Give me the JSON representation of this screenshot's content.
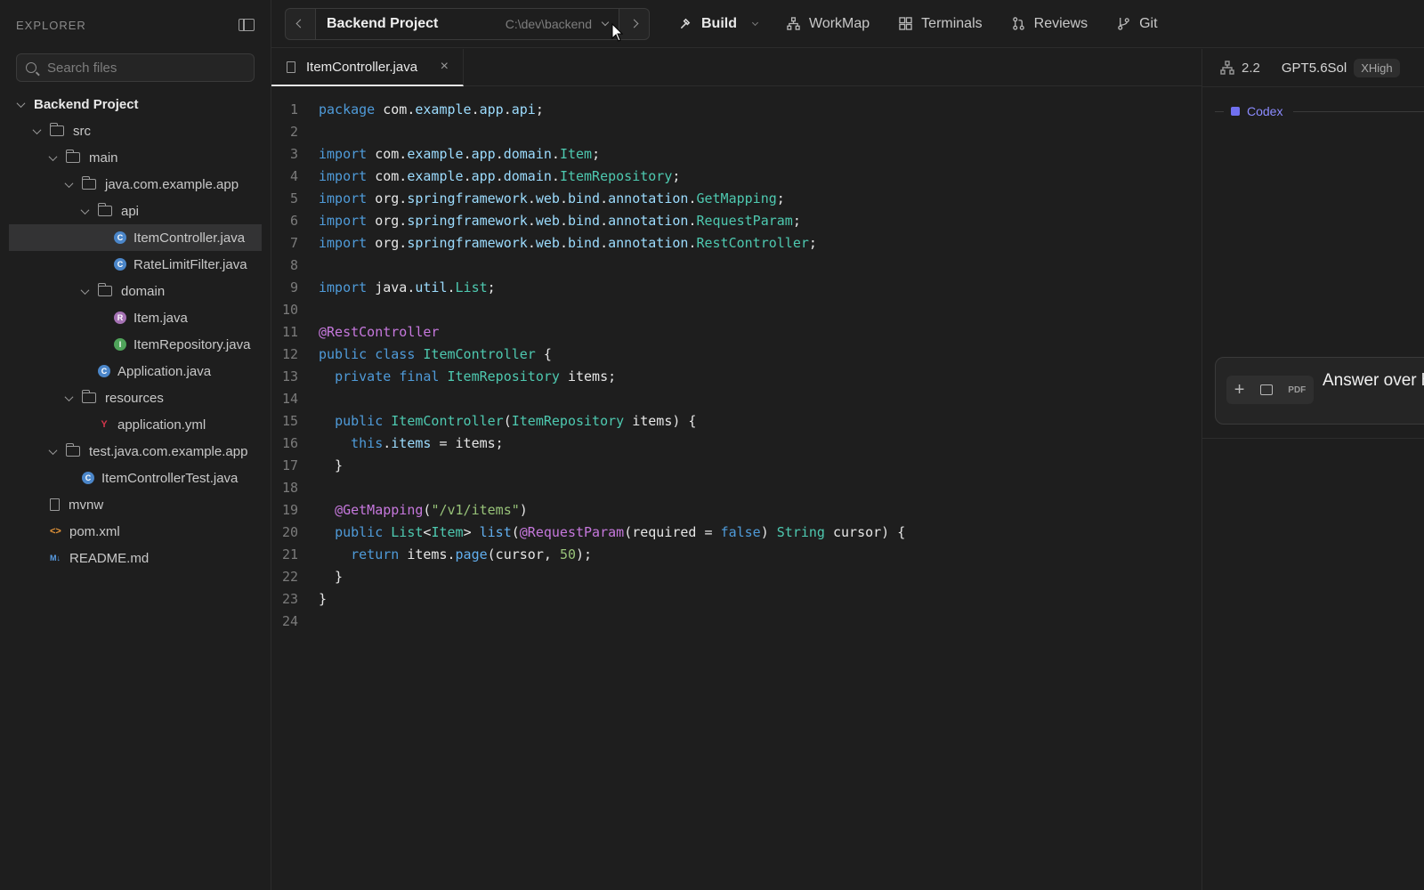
{
  "explorer": {
    "title": "EXPLORER",
    "search_placeholder": "Search files",
    "tree": [
      {
        "label": "Backend Project",
        "depth": 0,
        "type": "root"
      },
      {
        "label": "src",
        "depth": 1,
        "type": "folder"
      },
      {
        "label": "main",
        "depth": 2,
        "type": "folder"
      },
      {
        "label": "java.com.example.app",
        "depth": 3,
        "type": "folder"
      },
      {
        "label": "api",
        "depth": 4,
        "type": "folder"
      },
      {
        "label": "ItemController.java",
        "depth": 5,
        "type": "class",
        "selected": true
      },
      {
        "label": "RateLimitFilter.java",
        "depth": 5,
        "type": "class"
      },
      {
        "label": "domain",
        "depth": 4,
        "type": "folder"
      },
      {
        "label": "Item.java",
        "depth": 5,
        "type": "record"
      },
      {
        "label": "ItemRepository.java",
        "depth": 5,
        "type": "interface"
      },
      {
        "label": "Application.java",
        "depth": 4,
        "type": "class"
      },
      {
        "label": "resources",
        "depth": 3,
        "type": "folder"
      },
      {
        "label": "application.yml",
        "depth": 4,
        "type": "yml"
      },
      {
        "label": "test.java.com.example.app",
        "depth": 2,
        "type": "folder"
      },
      {
        "label": "ItemControllerTest.java",
        "depth": 3,
        "type": "class"
      },
      {
        "label": "mvnw",
        "depth": 1,
        "type": "file"
      },
      {
        "label": "pom.xml",
        "depth": 1,
        "type": "xml"
      },
      {
        "label": "README.md",
        "depth": 1,
        "type": "md"
      }
    ]
  },
  "topbar": {
    "project_name": "Backend Project",
    "project_path": "C:\\dev\\backend",
    "menu": [
      {
        "label": "Build",
        "icon": "hammer-icon"
      },
      {
        "label": "WorkMap",
        "icon": "sitemap-icon"
      },
      {
        "label": "Terminals",
        "icon": "grid-icon"
      },
      {
        "label": "Reviews",
        "icon": "git-pull-request-icon"
      },
      {
        "label": "Git",
        "icon": "git-branch-icon"
      }
    ]
  },
  "editor": {
    "tab_label": "ItemController.java",
    "tab_close": "×",
    "lines": [
      [
        [
          "kw",
          "package"
        ],
        [
          "p",
          " com."
        ],
        [
          "id",
          "example"
        ],
        [
          "p",
          "."
        ],
        [
          "id",
          "app"
        ],
        [
          "p",
          "."
        ],
        [
          "id",
          "api"
        ],
        [
          "p",
          ";"
        ]
      ],
      [],
      [
        [
          "kw",
          "import"
        ],
        [
          "p",
          " com."
        ],
        [
          "id",
          "example"
        ],
        [
          "p",
          "."
        ],
        [
          "id",
          "app"
        ],
        [
          "p",
          "."
        ],
        [
          "id",
          "domain"
        ],
        [
          "p",
          "."
        ],
        [
          "ty",
          "Item"
        ],
        [
          "p",
          ";"
        ]
      ],
      [
        [
          "kw",
          "import"
        ],
        [
          "p",
          " com."
        ],
        [
          "id",
          "example"
        ],
        [
          "p",
          "."
        ],
        [
          "id",
          "app"
        ],
        [
          "p",
          "."
        ],
        [
          "id",
          "domain"
        ],
        [
          "p",
          "."
        ],
        [
          "ty",
          "ItemRepository"
        ],
        [
          "p",
          ";"
        ]
      ],
      [
        [
          "kw",
          "import"
        ],
        [
          "p",
          " org."
        ],
        [
          "id",
          "springframework"
        ],
        [
          "p",
          "."
        ],
        [
          "id",
          "web"
        ],
        [
          "p",
          "."
        ],
        [
          "id",
          "bind"
        ],
        [
          "p",
          "."
        ],
        [
          "id",
          "annotation"
        ],
        [
          "p",
          "."
        ],
        [
          "ty",
          "GetMapping"
        ],
        [
          "p",
          ";"
        ]
      ],
      [
        [
          "kw",
          "import"
        ],
        [
          "p",
          " org."
        ],
        [
          "id",
          "springframework"
        ],
        [
          "p",
          "."
        ],
        [
          "id",
          "web"
        ],
        [
          "p",
          "."
        ],
        [
          "id",
          "bind"
        ],
        [
          "p",
          "."
        ],
        [
          "id",
          "annotation"
        ],
        [
          "p",
          "."
        ],
        [
          "ty",
          "RequestParam"
        ],
        [
          "p",
          ";"
        ]
      ],
      [
        [
          "kw",
          "import"
        ],
        [
          "p",
          " org."
        ],
        [
          "id",
          "springframework"
        ],
        [
          "p",
          "."
        ],
        [
          "id",
          "web"
        ],
        [
          "p",
          "."
        ],
        [
          "id",
          "bind"
        ],
        [
          "p",
          "."
        ],
        [
          "id",
          "annotation"
        ],
        [
          "p",
          "."
        ],
        [
          "ty",
          "RestController"
        ],
        [
          "p",
          ";"
        ]
      ],
      [],
      [
        [
          "kw",
          "import"
        ],
        [
          "p",
          " java."
        ],
        [
          "id",
          "util"
        ],
        [
          "p",
          "."
        ],
        [
          "ty",
          "List"
        ],
        [
          "p",
          ";"
        ]
      ],
      [],
      [
        [
          "an",
          "@RestController"
        ]
      ],
      [
        [
          "kw",
          "public"
        ],
        [
          "p",
          " "
        ],
        [
          "kw",
          "class"
        ],
        [
          "p",
          " "
        ],
        [
          "cl",
          "ItemController"
        ],
        [
          "p",
          " {"
        ]
      ],
      [
        [
          "p",
          "  "
        ],
        [
          "kw",
          "private"
        ],
        [
          "p",
          " "
        ],
        [
          "kw",
          "final"
        ],
        [
          "p",
          " "
        ],
        [
          "cl",
          "ItemRepository"
        ],
        [
          "p",
          " items;"
        ]
      ],
      [],
      [
        [
          "p",
          "  "
        ],
        [
          "kw",
          "public"
        ],
        [
          "p",
          " "
        ],
        [
          "cl",
          "ItemController"
        ],
        [
          "p",
          "("
        ],
        [
          "cl",
          "ItemRepository"
        ],
        [
          "p",
          " items) {"
        ]
      ],
      [
        [
          "p",
          "    "
        ],
        [
          "kw",
          "this"
        ],
        [
          "p",
          "."
        ],
        [
          "id",
          "items"
        ],
        [
          "p",
          " = items;"
        ]
      ],
      [
        [
          "p",
          "  }"
        ]
      ],
      [],
      [
        [
          "p",
          "  "
        ],
        [
          "an",
          "@GetMapping"
        ],
        [
          "p",
          "("
        ],
        [
          "st",
          "\"/v1/items\""
        ],
        [
          "p",
          ")"
        ]
      ],
      [
        [
          "p",
          "  "
        ],
        [
          "kw",
          "public"
        ],
        [
          "p",
          " "
        ],
        [
          "cl",
          "List"
        ],
        [
          "p",
          "<"
        ],
        [
          "cl",
          "Item"
        ],
        [
          "p",
          "> "
        ],
        [
          "fn",
          "list"
        ],
        [
          "p",
          "("
        ],
        [
          "an",
          "@RequestParam"
        ],
        [
          "p",
          "(required = "
        ],
        [
          "kw",
          "false"
        ],
        [
          "p",
          ") "
        ],
        [
          "cl",
          "String"
        ],
        [
          "p",
          " cursor) {"
        ]
      ],
      [
        [
          "p",
          "    "
        ],
        [
          "kw",
          "return"
        ],
        [
          "p",
          " items."
        ],
        [
          "fn",
          "page"
        ],
        [
          "p",
          "(cursor, "
        ],
        [
          "nu",
          "50"
        ],
        [
          "p",
          ");"
        ]
      ],
      [
        [
          "p",
          "  }"
        ]
      ],
      [
        [
          "p",
          "}"
        ]
      ],
      []
    ]
  },
  "syntax_colors": {
    "kw": "#4f9bd9",
    "id": "#9cdcfe",
    "ty": "#4ec9b0",
    "cl": "#4ec9b0",
    "an": "#c678dd",
    "st": "#98c379",
    "fn": "#61afef",
    "nu": "#98c379",
    "p": "#e6e6e6"
  },
  "right_panel": {
    "version": "2.2",
    "model": "GPT5.6Sol",
    "effort": "XHigh",
    "section_label": "Codex",
    "composer_text": "Answer over hint",
    "pdf_label": "PDF",
    "plus_label": "+"
  }
}
